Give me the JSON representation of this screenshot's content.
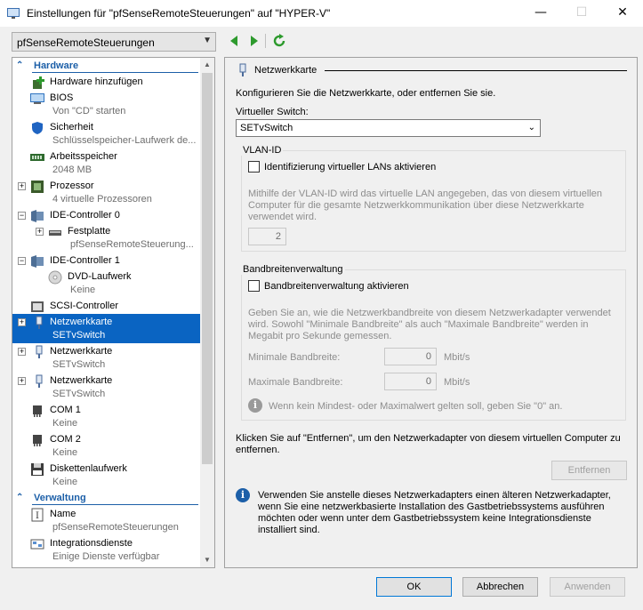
{
  "window": {
    "title": "Einstellungen für \"pfSenseRemoteSteuerungen\" auf \"HYPER-V\"",
    "minimize_glyph": "—",
    "maximize_glyph": "☐",
    "close_glyph": "✕"
  },
  "vm_selector": {
    "value": "pfSenseRemoteSteuerungen"
  },
  "tree": {
    "hardware_header": "Hardware",
    "management_header": "Verwaltung",
    "items": [
      {
        "label": "Hardware hinzufügen",
        "sub": "",
        "icon": "add-hardware-icon"
      },
      {
        "label": "BIOS",
        "sub": "Von \"CD\" starten",
        "icon": "bios-icon"
      },
      {
        "label": "Sicherheit",
        "sub": "Schlüsselspeicher-Laufwerk de...",
        "icon": "shield-icon"
      },
      {
        "label": "Arbeitsspeicher",
        "sub": "2048 MB",
        "icon": "memory-icon"
      },
      {
        "label": "Prozessor",
        "sub": "4 virtuelle Prozessoren",
        "icon": "processor-icon"
      },
      {
        "label": "IDE-Controller 0",
        "sub": "",
        "icon": "ide-controller-icon"
      },
      {
        "label": "Festplatte",
        "sub": "pfSenseRemoteSteuerung...",
        "icon": "hard-disk-icon"
      },
      {
        "label": "IDE-Controller 1",
        "sub": "",
        "icon": "ide-controller-icon"
      },
      {
        "label": "DVD-Laufwerk",
        "sub": "Keine",
        "icon": "dvd-icon"
      },
      {
        "label": "SCSI-Controller",
        "sub": "",
        "icon": "scsi-controller-icon"
      },
      {
        "label": "Netzwerkkarte",
        "sub": "SETvSwitch",
        "icon": "network-adapter-icon"
      },
      {
        "label": "Netzwerkkarte",
        "sub": "SETvSwitch",
        "icon": "network-adapter-icon"
      },
      {
        "label": "Netzwerkkarte",
        "sub": "SETvSwitch",
        "icon": "network-adapter-icon"
      },
      {
        "label": "COM 1",
        "sub": "Keine",
        "icon": "com-port-icon"
      },
      {
        "label": "COM 2",
        "sub": "Keine",
        "icon": "com-port-icon"
      },
      {
        "label": "Diskettenlaufwerk",
        "sub": "Keine",
        "icon": "floppy-icon"
      },
      {
        "label": "Name",
        "sub": "pfSenseRemoteSteuerungen",
        "icon": "name-icon"
      },
      {
        "label": "Integrationsdienste",
        "sub": "Einige Dienste verfügbar",
        "icon": "integration-services-icon"
      }
    ]
  },
  "panel": {
    "section_title": "Netzwerkkarte",
    "intro": "Konfigurieren Sie die Netzwerkkarte, oder entfernen Sie sie.",
    "switch_label": "Virtueller Switch:",
    "switch_value": "SETvSwitch",
    "vlan": {
      "title": "VLAN-ID",
      "checkbox_label": "Identifizierung virtueller LANs aktivieren",
      "description": "Mithilfe der VLAN-ID wird das virtuelle LAN angegeben, das von diesem virtuellen Computer für die gesamte Netzwerkkommunikation über diese Netzwerkkarte verwendet wird.",
      "value": "2"
    },
    "bandwidth": {
      "title": "Bandbreitenverwaltung",
      "checkbox_label": "Bandbreitenverwaltung aktivieren",
      "description": "Geben Sie an, wie die Netzwerkbandbreite von diesem Netzwerkadapter verwendet wird. Sowohl \"Minimale Bandbreite\" als auch \"Maximale Bandbreite\" werden in Megabit pro Sekunde gemessen.",
      "min_label": "Minimale Bandbreite:",
      "min_value": "0",
      "max_label": "Maximale Bandbreite:",
      "max_value": "0",
      "unit": "Mbit/s",
      "note": "Wenn kein Mindest- oder Maximalwert gelten soll, geben Sie \"0\" an."
    },
    "remove_text": "Klicken Sie auf \"Entfernen\", um den Netzwerkadapter von diesem virtuellen Computer zu entfernen.",
    "remove_button": "Entfernen",
    "info_text": "Verwenden Sie anstelle dieses Netzwerkadapters einen älteren Netzwerkadapter, wenn Sie eine netzwerkbasierte Installation des Gastbetriebssystems ausführen möchten oder wenn unter dem Gastbetriebssystem keine Integrationsdienste installiert sind."
  },
  "footer": {
    "ok": "OK",
    "cancel": "Abbrechen",
    "apply": "Anwenden"
  },
  "colors": {
    "accent": "#1c5fa8",
    "selection": "#0a64c2",
    "disabled_text": "#8d8d8d"
  }
}
